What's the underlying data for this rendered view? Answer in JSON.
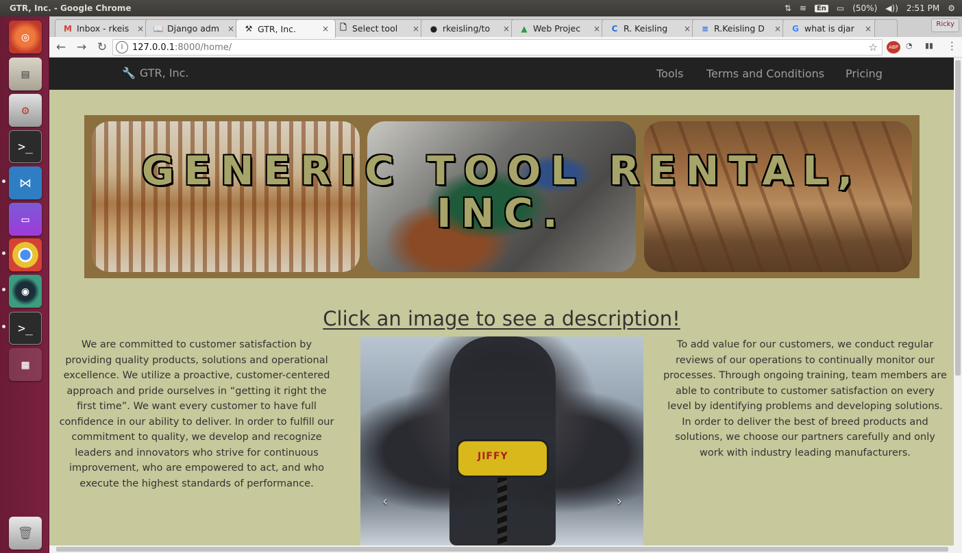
{
  "os": {
    "window_title": "GTR, Inc. - Google Chrome",
    "lang_indicator": "En",
    "battery": "(50%)",
    "time": "2:51 PM"
  },
  "browser": {
    "tabs": [
      {
        "favicon": "M",
        "label": "Inbox - rkeis",
        "close": "×"
      },
      {
        "favicon": "📖",
        "label": "Django adm",
        "close": "×"
      },
      {
        "favicon": "⚒",
        "label": "GTR, Inc.",
        "close": "×"
      },
      {
        "favicon": "🗋",
        "label": "Select tool",
        "close": "×"
      },
      {
        "favicon": "●",
        "label": "rkeisling/to",
        "close": "×"
      },
      {
        "favicon": "▲",
        "label": "Web Projec",
        "close": "×"
      },
      {
        "favicon": "C",
        "label": "R. Keisling",
        "close": "×"
      },
      {
        "favicon": "≡",
        "label": "R.Keisling D",
        "close": "×"
      },
      {
        "favicon": "G",
        "label": "what is djar",
        "close": "×"
      }
    ],
    "profile_label": "Ricky",
    "url_host": "127.0.0.1",
    "url_rest": ":8000/home/",
    "ext_abp": "ABP"
  },
  "site": {
    "brand": "GTR, Inc.",
    "nav": [
      "Tools",
      "Terms and Conditions",
      "Pricing"
    ],
    "banner_title_line1": "GENERIC TOOL RENTAL,",
    "banner_title_line2": "INC.",
    "heading": "Click an image to see a description!",
    "left_paragraph": "We are committed to customer satisfaction by providing quality products, solutions and operational excellence. We utilize a proactive, customer-centered approach and pride ourselves in “getting it right the first time”. We want every customer to have full confidence in our ability to deliver. In order to fulfill our commitment to quality, we develop and recognize leaders and innovators who strive for continuous improvement, who are empowered to act, and who execute the highest standards of performance.",
    "right_paragraph": "To add value for our customers, we conduct regular reviews of our operations to continually monitor our processes. Through ongoing training, team members are able to contribute to customer satisfaction on every level by identifying problems and developing solutions. In order to deliver the best of breed products and solutions, we choose our partners carefully and only work with industry leading manufacturers.",
    "carousel_prev": "‹",
    "carousel_next": "›",
    "drill_brand": "JIFFY"
  }
}
